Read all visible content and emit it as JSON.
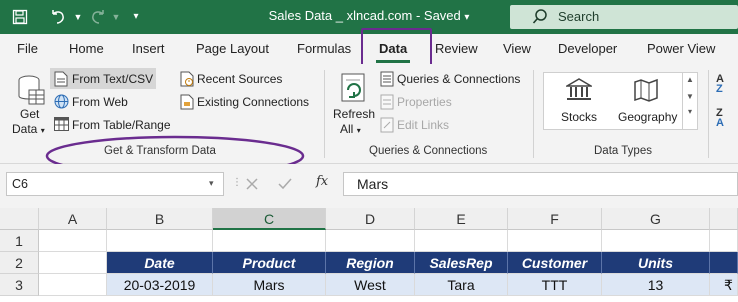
{
  "titlebar": {
    "title": "Sales Data _ xlncad.com  -  Saved",
    "search_placeholder": "Search",
    "bg_color": "#217346"
  },
  "tabs": [
    "File",
    "Home",
    "Insert",
    "Page Layout",
    "Formulas",
    "Data",
    "Review",
    "View",
    "Developer",
    "Power View"
  ],
  "active_tab": "Data",
  "ribbon": {
    "get_data": {
      "line1": "Get",
      "line2": "Data"
    },
    "from_text_csv": "From Text/CSV",
    "from_web": "From Web",
    "from_table_range": "From Table/Range",
    "recent_sources": "Recent Sources",
    "existing_connections": "Existing Connections",
    "group_get_transform": "Get & Transform Data",
    "refresh": {
      "line1": "Refresh",
      "line2": "All"
    },
    "queries_connections": "Queries & Connections",
    "properties": "Properties",
    "edit_links": "Edit Links",
    "group_queries": "Queries & Connections",
    "stocks": "Stocks",
    "geography": "Geography",
    "group_data_types": "Data Types",
    "sort_az": "A↓Z",
    "sort_za": "Z↓A"
  },
  "formula_bar": {
    "name_box": "C6",
    "fx": "fx",
    "value": "Mars"
  },
  "grid": {
    "columns": [
      "A",
      "B",
      "C",
      "D",
      "E",
      "F",
      "G"
    ],
    "selected_column": "C",
    "rows": [
      "1",
      "2",
      "3"
    ],
    "header_row": [
      "Date",
      "Product",
      "Region",
      "SalesRep",
      "Customer",
      "Units"
    ],
    "data_row": [
      "20-03-2019",
      "Mars",
      "West",
      "Tara",
      "TTT",
      "13"
    ],
    "partial_cell": "₹",
    "header_color": "#1f3b78",
    "data_color": "#dde7f5"
  }
}
